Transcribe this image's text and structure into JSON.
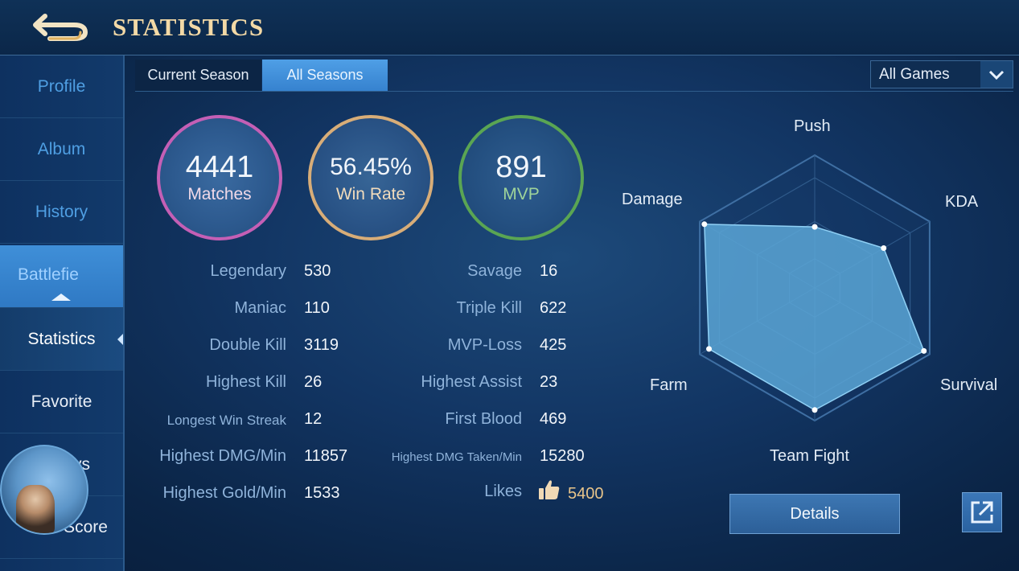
{
  "header": {
    "title": "STATISTICS",
    "back_icon": "back-arrow-icon"
  },
  "sidebar": {
    "items": [
      {
        "label": "Profile"
      },
      {
        "label": "Album"
      },
      {
        "label": "History"
      },
      {
        "label": "Battlefie"
      },
      {
        "label": "Statistics"
      },
      {
        "label": "Favorite"
      },
      {
        "label": "ys"
      },
      {
        "label": "Score"
      }
    ]
  },
  "tabs": {
    "current": "Current Season",
    "all": "All Seasons"
  },
  "filter": {
    "selected": "All Games"
  },
  "summary": {
    "matches": {
      "value": "4441",
      "label": "Matches"
    },
    "win_rate": {
      "value": "56.45%",
      "label": "Win Rate"
    },
    "mvp": {
      "value": "891",
      "label": "MVP"
    }
  },
  "stats_left": [
    {
      "label": "Legendary",
      "value": "530"
    },
    {
      "label": "Maniac",
      "value": "110"
    },
    {
      "label": "Double Kill",
      "value": "3119"
    },
    {
      "label": "Highest Kill",
      "value": "26"
    },
    {
      "label": "Longest Win Streak",
      "value": "12"
    },
    {
      "label": "Highest DMG/Min",
      "value": "11857"
    },
    {
      "label": "Highest Gold/Min",
      "value": "1533"
    }
  ],
  "stats_right": [
    {
      "label": "Savage",
      "value": "16"
    },
    {
      "label": "Triple Kill",
      "value": "622"
    },
    {
      "label": "MVP-Loss",
      "value": "425"
    },
    {
      "label": "Highest Assist",
      "value": "23"
    },
    {
      "label": "First Blood",
      "value": "469"
    },
    {
      "label": "Highest DMG Taken/Min",
      "value": "15280"
    },
    {
      "label": "Likes",
      "value": "5400"
    }
  ],
  "radar": {
    "axes": [
      "Push",
      "KDA",
      "Survival",
      "Team Fight",
      "Farm",
      "Damage"
    ],
    "values": [
      0.46,
      0.6,
      0.95,
      0.92,
      0.92,
      0.96
    ],
    "fill_color": "#5aa6d6"
  },
  "buttons": {
    "details": "Details",
    "share_icon": "share-icon"
  },
  "colors": {
    "title": "#f3d9a6",
    "matches_ring": "#c45fb5",
    "winrate_ring": "#d8ad78",
    "mvp_ring": "#5aa553"
  }
}
